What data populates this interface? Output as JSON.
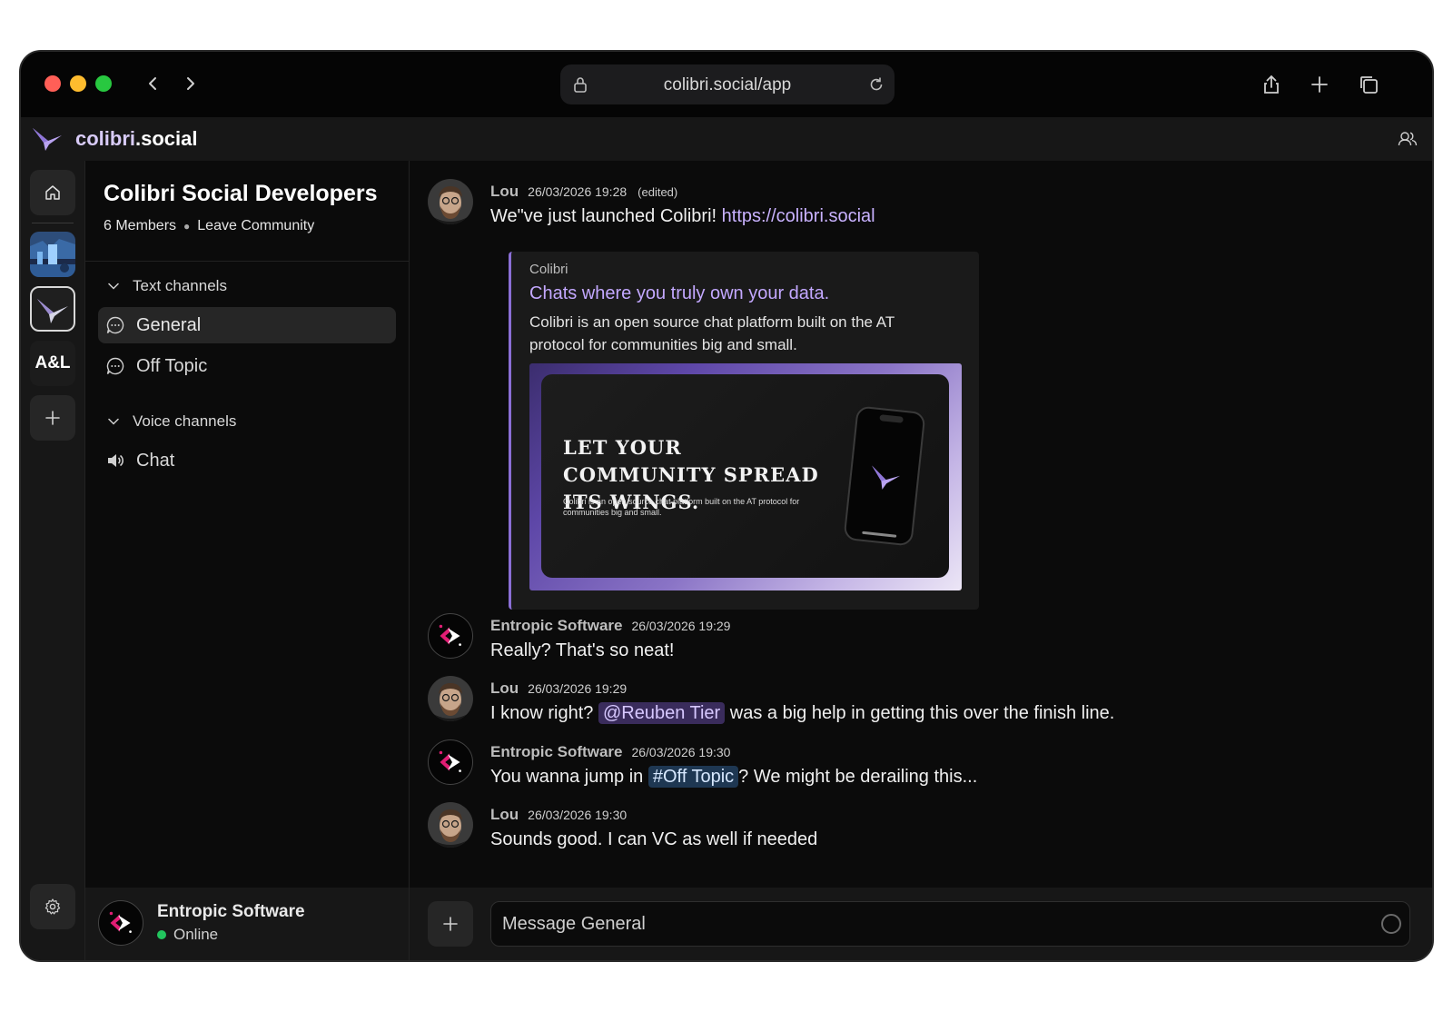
{
  "browser": {
    "url": "colibri.social/app"
  },
  "app": {
    "brand_main": "colibri",
    "brand_suffix": ".social"
  },
  "rail": {
    "items": [
      "home",
      "community-image",
      "colibri",
      "A&L",
      "add"
    ],
    "al_label": "A&L"
  },
  "community": {
    "name": "Colibri Social Developers",
    "members": "6 Members",
    "leave": "Leave Community",
    "text_section": "Text channels",
    "voice_section": "Voice channels",
    "text_channels": [
      {
        "name": "General",
        "active": true
      },
      {
        "name": "Off Topic",
        "active": false
      }
    ],
    "voice_channels": [
      {
        "name": "Chat"
      }
    ]
  },
  "user": {
    "name": "Entropic Software",
    "status": "Online",
    "status_color": "#22c55e"
  },
  "messages": [
    {
      "author": "Lou",
      "time": "26/03/2026 19:28",
      "edited": "(edited)",
      "text": "We\"ve just launched Colibri! ",
      "link": "https://colibri.social",
      "embed": {
        "site": "Colibri",
        "title": "Chats where you truly own your data.",
        "description": "Colibri is an open source chat platform built on the AT protocol for communities big and small.",
        "image_headline": "LET YOUR COMMUNITY SPREAD ITS WINGS.",
        "image_sub": "Colibri is an open source chat platform built on the AT protocol for communities big and small."
      }
    },
    {
      "author": "Entropic Software",
      "time": "26/03/2026 19:29",
      "text": "Really? That's so neat!"
    },
    {
      "author": "Lou",
      "time": "26/03/2026 19:29",
      "text_before": "I know right? ",
      "mention": "@Reuben Tier",
      "text_after": " was a big help in getting this over the finish line."
    },
    {
      "author": "Entropic Software",
      "time": "26/03/2026 19:30",
      "text_before": "You wanna jump in ",
      "channel_ref": "#Off Topic",
      "text_after": "? We might be derailing this..."
    },
    {
      "author": "Lou",
      "time": "26/03/2026 19:30",
      "text": "Sounds good. I can VC as well if needed"
    }
  ],
  "composer": {
    "placeholder": "Message General"
  },
  "colors": {
    "accent": "#c9b2ff",
    "mention_bg": "#3a2c5c",
    "channel_ref_bg": "#1e3752"
  }
}
